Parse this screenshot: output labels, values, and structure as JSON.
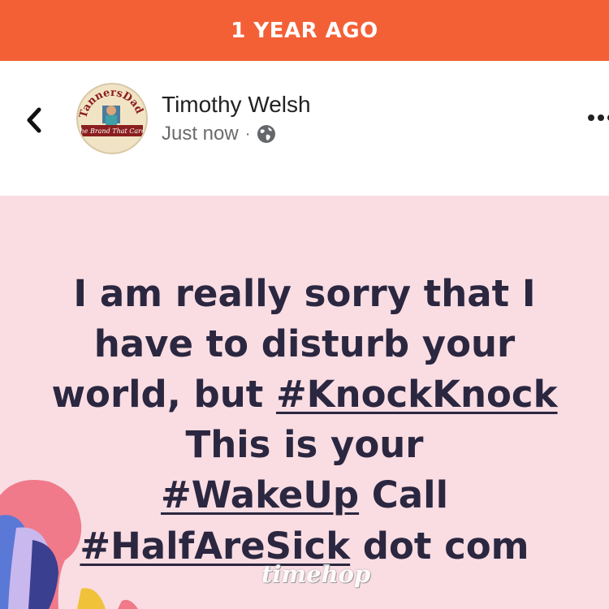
{
  "banner": {
    "label": "1 YEAR AGO"
  },
  "post_header": {
    "author": "Timothy Welsh",
    "timestamp": "Just now",
    "separator": "·",
    "privacy_icon": "globe-icon",
    "back_icon": "chevron-left-icon",
    "more_icon": "more-dots-icon",
    "avatar_badge_text": "TannersDad",
    "avatar_banner_text": "The Brand That Cares"
  },
  "post_body": {
    "line1": "I am really sorry that I",
    "line2": "have to disturb your",
    "line3_prefix": "world, but ",
    "line3_tag": "#KnockKnock",
    "line4": "This is your",
    "line5_tag": "#WakeUp",
    "line5_suffix": " Call",
    "line6_tag": "#HalfAreSick",
    "line6_suffix": " dot com"
  },
  "watermark": {
    "text": "timehop"
  },
  "colors": {
    "banner": "#f46036",
    "post_bg": "#f9dde3",
    "text": "#2b2740"
  }
}
